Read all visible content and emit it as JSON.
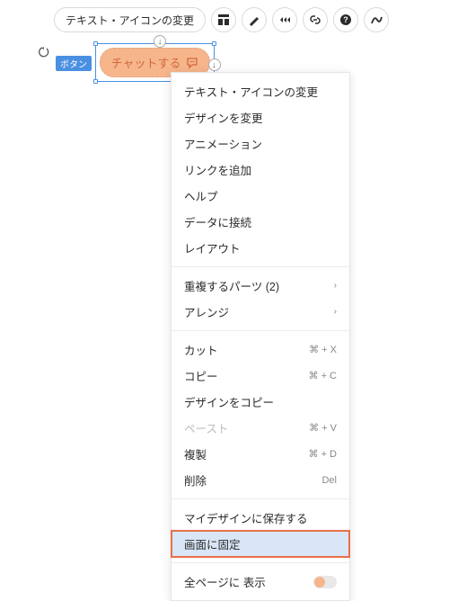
{
  "toolbar": {
    "main_button_label": "テキスト・アイコンの変更"
  },
  "selection": {
    "tag_label": "ボタン",
    "button_text": "チャットする"
  },
  "menu": {
    "items": [
      {
        "label": "テキスト・アイコンの変更"
      },
      {
        "label": "デザインを変更"
      },
      {
        "label": "アニメーション"
      },
      {
        "label": "リンクを追加"
      },
      {
        "label": "ヘルプ"
      },
      {
        "label": "データに接続"
      },
      {
        "label": "レイアウト"
      }
    ],
    "items2": [
      {
        "label": "重複するパーツ (2)",
        "submenu": true
      },
      {
        "label": "アレンジ",
        "submenu": true
      }
    ],
    "items3": [
      {
        "label": "カット",
        "shortcut": "⌘ + X"
      },
      {
        "label": "コピー",
        "shortcut": "⌘ + C"
      },
      {
        "label": "デザインをコピー"
      },
      {
        "label": "ペースト",
        "shortcut": "⌘ + V",
        "disabled": true
      },
      {
        "label": "複製",
        "shortcut": "⌘ + D"
      },
      {
        "label": "削除",
        "shortcut": "Del"
      }
    ],
    "items4": [
      {
        "label": "マイデザインに保存する"
      },
      {
        "label": "画面に固定",
        "highlighted": true
      }
    ],
    "items5": [
      {
        "label": "全ページに 表示",
        "toggle": true
      }
    ]
  }
}
